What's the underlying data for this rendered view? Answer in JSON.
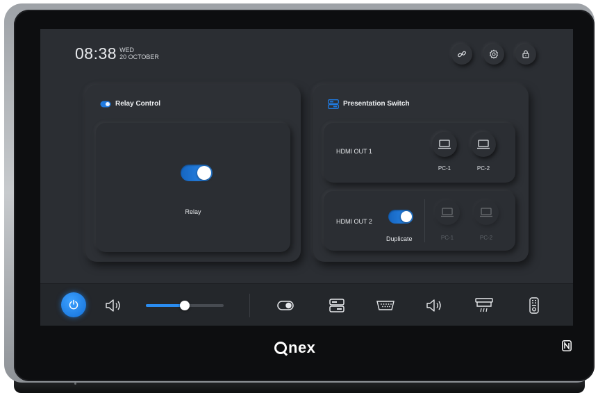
{
  "header": {
    "time": "08:38",
    "weekday": "WED",
    "date": "20 OCTOBER",
    "buttons": [
      "link-icon",
      "settings-icon",
      "lock-icon"
    ]
  },
  "relay_card": {
    "title": "Relay Control",
    "relay_label": "Relay",
    "relay_on": true
  },
  "presentation_card": {
    "title": "Presentation Switch",
    "out1": {
      "label": "HDMI OUT 1",
      "sources": [
        "PC-1",
        "PC-2"
      ]
    },
    "out2": {
      "label": "HDMI OUT 2",
      "duplicate_label": "Duplicate",
      "duplicate_on": true,
      "sources": [
        "PC-1",
        "PC-2"
      ]
    }
  },
  "bottom_bar": {
    "power_on": true,
    "volume_level": 0.5,
    "icons": [
      "power-icon",
      "speaker-icon",
      "toggle-icon",
      "switcher-icon",
      "serial-port-icon",
      "speaker-icon",
      "projector-screen-icon",
      "remote-control-icon"
    ]
  },
  "brand": {
    "name": "nex"
  },
  "colors": {
    "accent": "#2a8cf0",
    "screen_bg": "#2b2e33",
    "bar_bg": "#24272b"
  }
}
